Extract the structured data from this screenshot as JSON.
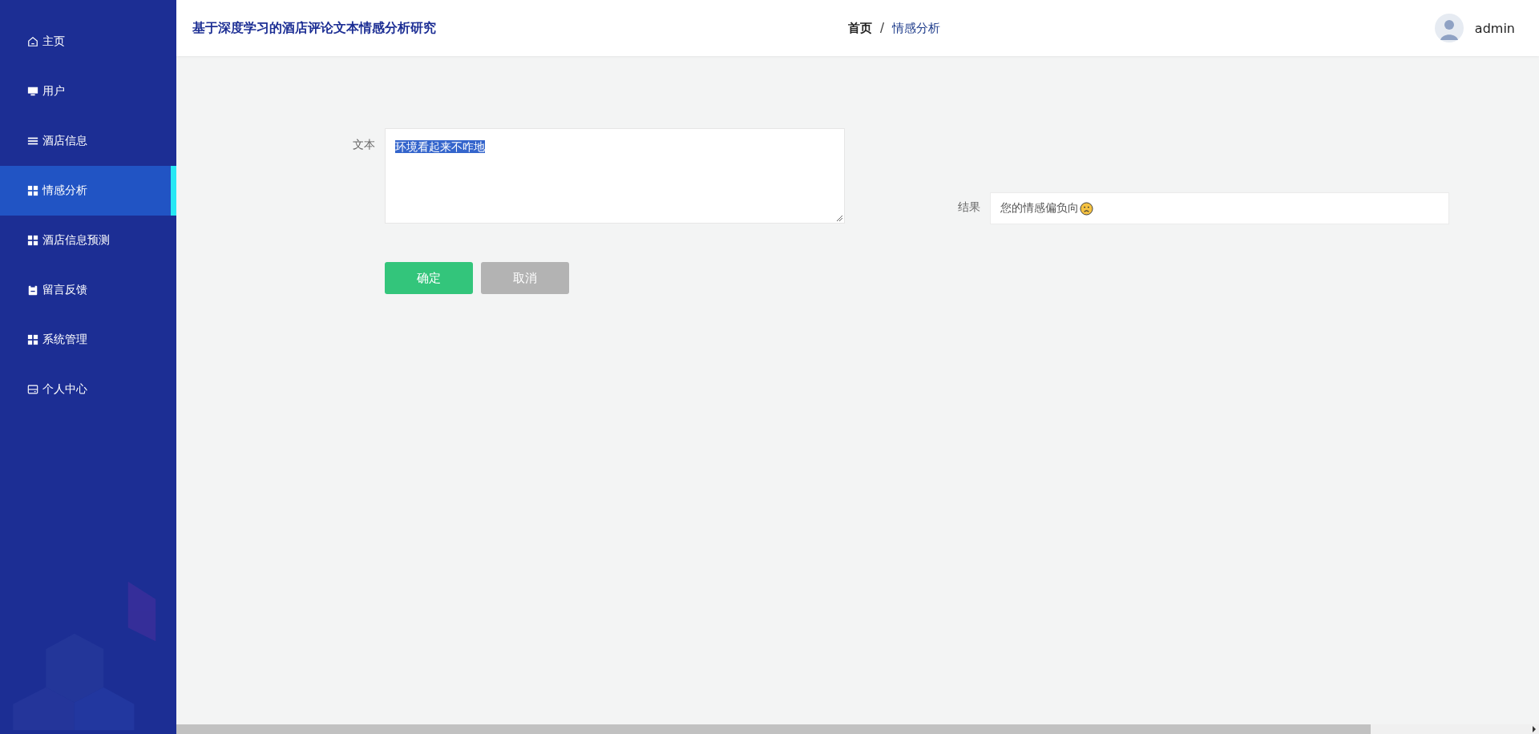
{
  "sidebar": {
    "items": [
      {
        "label": "主页",
        "selected": false
      },
      {
        "label": "用户",
        "selected": false
      },
      {
        "label": "酒店信息",
        "selected": false
      },
      {
        "label": "情感分析",
        "selected": true
      },
      {
        "label": "酒店信息预测",
        "selected": false
      },
      {
        "label": "留言反馈",
        "selected": false
      },
      {
        "label": "系统管理",
        "selected": false
      },
      {
        "label": "个人中心",
        "selected": false
      }
    ]
  },
  "header": {
    "title": "基于深度学习的酒店评论文本情感分析研究",
    "breadcrumb": [
      {
        "label": "首页",
        "current": false
      },
      {
        "label": "情感分析",
        "current": true
      }
    ],
    "separator": "/",
    "user": "admin"
  },
  "form": {
    "text_label": "文本",
    "text_value": "环境看起来不咋地",
    "text_selected": true,
    "buttons": [
      {
        "label": "确定",
        "kind": "primary"
      },
      {
        "label": "取消",
        "kind": "secondary"
      }
    ],
    "result_label": "结果",
    "result_value": "您的情感偏负向",
    "result_negative": true
  }
}
